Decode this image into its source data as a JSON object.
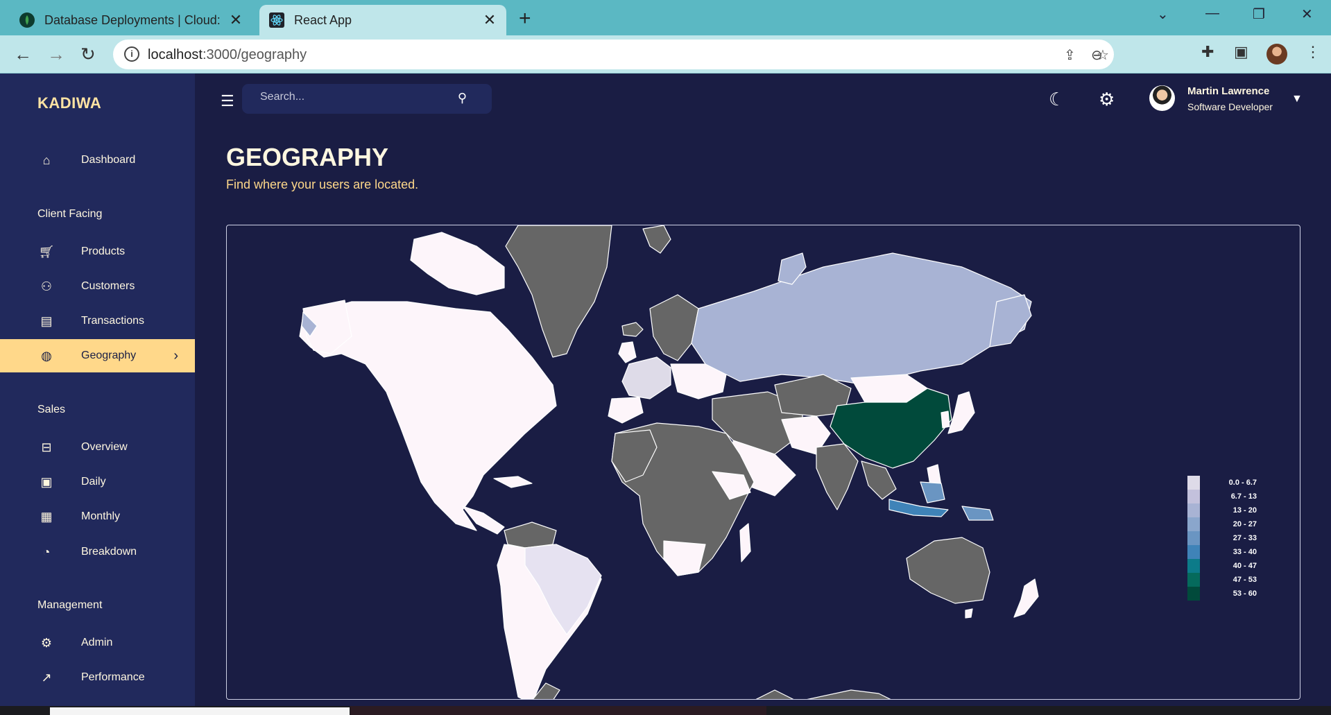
{
  "browser": {
    "tabs": [
      {
        "title": "Database Deployments | Cloud: M",
        "active": false
      },
      {
        "title": "React App",
        "active": true
      }
    ],
    "url_host": "localhost",
    "url_path": ":3000/geography"
  },
  "app": {
    "brand": "KADIWA",
    "search_placeholder": "Search...",
    "user": {
      "name": "Martin Lawrence",
      "role": "Software Developer"
    }
  },
  "sidebar": {
    "items": [
      {
        "label": "Dashboard",
        "icon": "home-icon"
      },
      {
        "section": "Client Facing"
      },
      {
        "label": "Products",
        "icon": "shopping-cart-icon"
      },
      {
        "label": "Customers",
        "icon": "groups-icon"
      },
      {
        "label": "Transactions",
        "icon": "receipt-icon"
      },
      {
        "label": "Geography",
        "icon": "globe-icon",
        "active": true
      },
      {
        "section": "Sales"
      },
      {
        "label": "Overview",
        "icon": "point-of-sale-icon"
      },
      {
        "label": "Daily",
        "icon": "calendar-today-icon"
      },
      {
        "label": "Monthly",
        "icon": "calendar-month-icon"
      },
      {
        "label": "Breakdown",
        "icon": "pie-chart-icon"
      },
      {
        "section": "Management"
      },
      {
        "label": "Admin",
        "icon": "admin-icon"
      },
      {
        "label": "Performance",
        "icon": "trending-up-icon"
      }
    ]
  },
  "page": {
    "title": "GEOGRAPHY",
    "subtitle": "Find where your users are located."
  },
  "legend": [
    {
      "label": "0.0 - 6.7",
      "color": "#dedbe8"
    },
    {
      "label": "6.7 - 13",
      "color": "#c3c1dc"
    },
    {
      "label": "13 - 20",
      "color": "#a8b3d4"
    },
    {
      "label": "20 - 27",
      "color": "#8aa6cc"
    },
    {
      "label": "27 - 33",
      "color": "#6a95c2"
    },
    {
      "label": "33 - 40",
      "color": "#3f83b8"
    },
    {
      "label": "40 - 47",
      "color": "#0c7b89"
    },
    {
      "label": "47 - 53",
      "color": "#056a5c"
    },
    {
      "label": "53 - 60",
      "color": "#014a3b"
    }
  ],
  "colors": {
    "sidebar_bg": "#21295c",
    "page_bg": "#1a1d44",
    "accent": "#ffd88a",
    "no_data": "#666666"
  }
}
